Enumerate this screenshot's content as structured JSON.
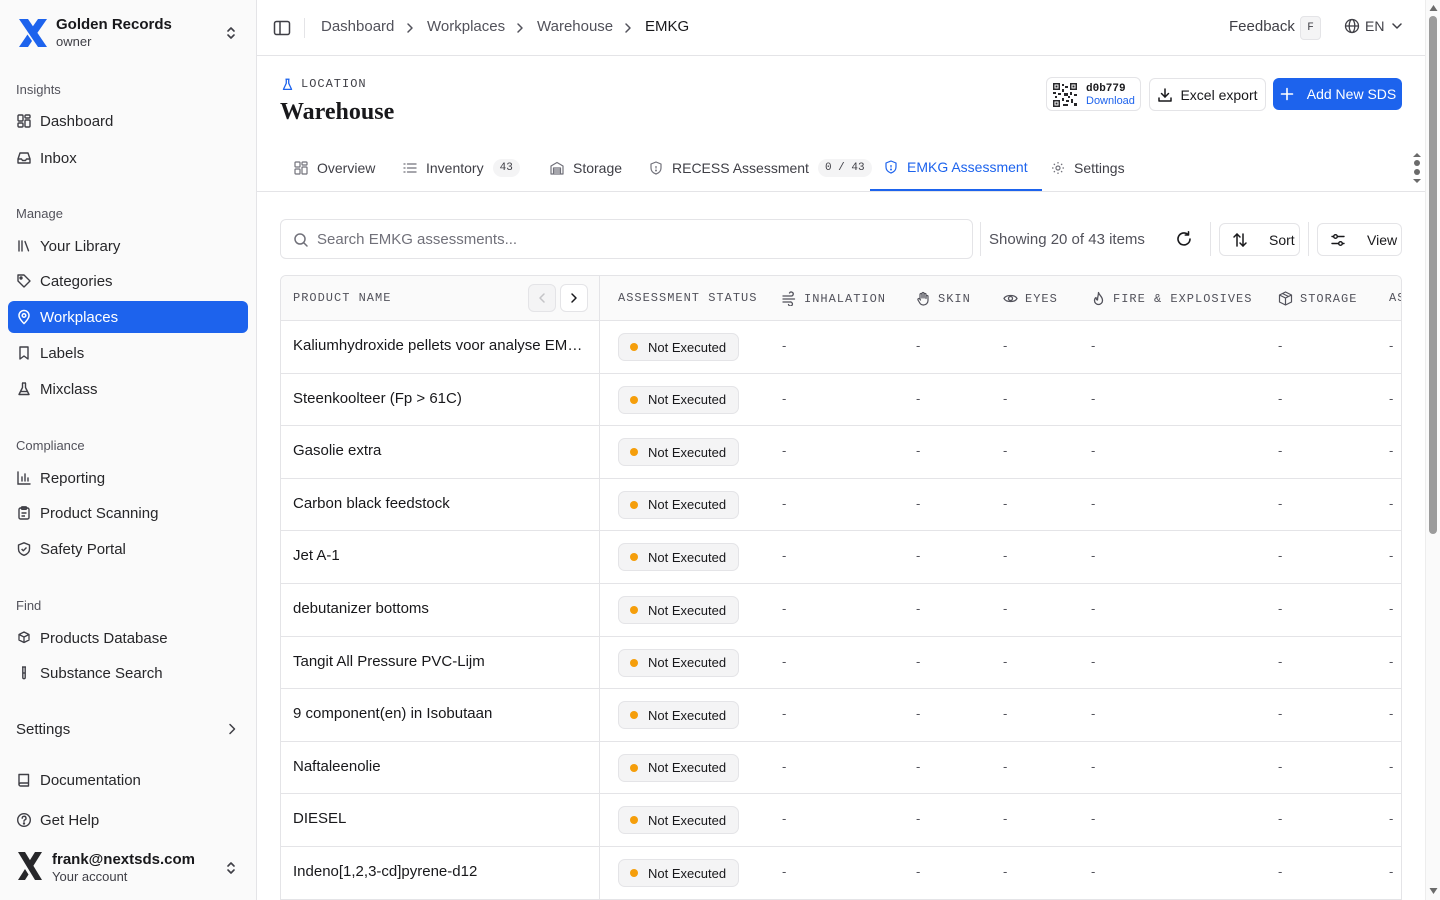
{
  "brand": {
    "name": "Golden Records",
    "role": "owner"
  },
  "sidebar": {
    "groups": [
      {
        "title": "Insights",
        "items": [
          {
            "label": "Dashboard",
            "icon": "dashboard-icon"
          },
          {
            "label": "Inbox",
            "icon": "inbox-icon"
          }
        ]
      },
      {
        "title": "Manage",
        "items": [
          {
            "label": "Your Library",
            "icon": "library-icon"
          },
          {
            "label": "Categories",
            "icon": "tag-icon"
          },
          {
            "label": "Workplaces",
            "icon": "map-pin-icon",
            "active": true
          },
          {
            "label": "Labels",
            "icon": "bookmark-icon"
          },
          {
            "label": "Mixclass",
            "icon": "flask-icon"
          }
        ]
      },
      {
        "title": "Compliance",
        "items": [
          {
            "label": "Reporting",
            "icon": "bar-chart-icon"
          },
          {
            "label": "Product Scanning",
            "icon": "clipboard-icon"
          },
          {
            "label": "Safety Portal",
            "icon": "shield-check-icon"
          }
        ]
      },
      {
        "title": "Find",
        "items": [
          {
            "label": "Products Database",
            "icon": "packages-icon"
          },
          {
            "label": "Substance Search",
            "icon": "test-tube-icon"
          }
        ]
      }
    ],
    "settings_label": "Settings",
    "footer_items": [
      {
        "label": "Documentation",
        "icon": "book-icon"
      },
      {
        "label": "Get Help",
        "icon": "help-circle-icon"
      }
    ],
    "account": {
      "email": "frank@nextsds.com",
      "subtitle": "Your account"
    }
  },
  "topbar": {
    "breadcrumbs": [
      "Dashboard",
      "Workplaces",
      "Warehouse",
      "EMKG"
    ],
    "feedback_label": "Feedback",
    "feedback_shortcut": "F",
    "language": "EN"
  },
  "header": {
    "section_label": "LOCATION",
    "title": "Warehouse",
    "qr_code": "d0b779",
    "qr_download": "Download",
    "excel_export": "Excel export",
    "add_sds": "Add New SDS"
  },
  "tabs": [
    {
      "label": "Overview",
      "icon": "overview-icon"
    },
    {
      "label": "Inventory",
      "icon": "list-icon",
      "count": "43"
    },
    {
      "label": "Storage",
      "icon": "warehouse-icon"
    },
    {
      "label": "RECESS Assessment",
      "icon": "shield-icon",
      "count": "0 / 43"
    },
    {
      "label": "EMKG Assessment",
      "icon": "shield-icon",
      "active": true
    },
    {
      "label": "Settings",
      "icon": "gear-icon"
    }
  ],
  "toolbar": {
    "search_placeholder": "Search EMKG assessments...",
    "showing": "Showing 20 of 43 items",
    "sort_label": "Sort",
    "view_label": "View"
  },
  "table": {
    "columns": [
      "PRODUCT NAME",
      "ASSESSMENT STATUS",
      "INHALATION",
      "SKIN",
      "EYES",
      "FIRE & EXPLOSIVES",
      "STORAGE",
      "AS"
    ],
    "rows": [
      {
        "name": "Kaliumhydroxide pellets voor analyse EMSURE",
        "status": "Not Executed"
      },
      {
        "name": "Steenkoolteer (Fp > 61C)",
        "status": "Not Executed"
      },
      {
        "name": "Gasolie extra",
        "status": "Not Executed"
      },
      {
        "name": "Carbon black feedstock",
        "status": "Not Executed"
      },
      {
        "name": "Jet A-1",
        "status": "Not Executed"
      },
      {
        "name": "debutanizer bottoms",
        "status": "Not Executed"
      },
      {
        "name": "Tangit All Pressure PVC-Lijm",
        "status": "Not Executed"
      },
      {
        "name": "9 component(en) in Isobutaan",
        "status": "Not Executed"
      },
      {
        "name": "Naftaleenolie",
        "status": "Not Executed"
      },
      {
        "name": "DIESEL",
        "status": "Not Executed"
      },
      {
        "name": "Indeno[1,2,3-cd]pyrene-d12",
        "status": "Not Executed"
      }
    ],
    "empty_cell": "-"
  },
  "colors": {
    "accent": "#1d63ed",
    "status_pending": "#f59e0b"
  }
}
